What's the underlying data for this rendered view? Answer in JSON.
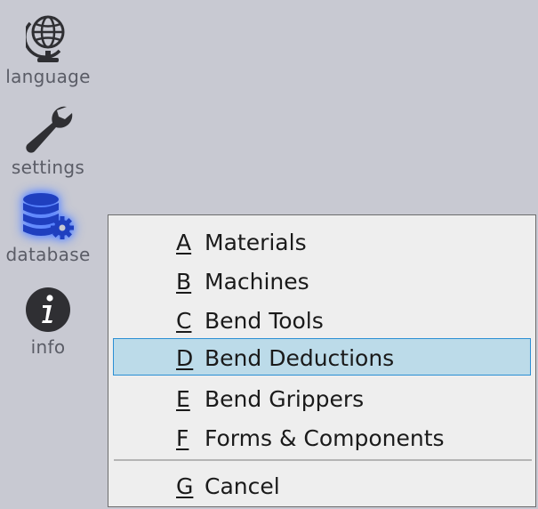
{
  "sidebar": {
    "items": [
      {
        "label": "language",
        "icon": "globe-icon"
      },
      {
        "label": "settings",
        "icon": "wrench-icon"
      },
      {
        "label": "database",
        "icon": "database-gear-icon",
        "active": true
      },
      {
        "label": "info",
        "icon": "info-icon"
      }
    ]
  },
  "menu": {
    "items": [
      {
        "key": "A",
        "label": "Materials"
      },
      {
        "key": "B",
        "label": "Machines"
      },
      {
        "key": "C",
        "label": "Bend Tools"
      },
      {
        "key": "D",
        "label": "Bend Deductions",
        "selected": true
      },
      {
        "key": "E",
        "label": "Bend Grippers"
      },
      {
        "key": "F",
        "label": "Forms & Components"
      },
      {
        "key": "G",
        "label": "Cancel"
      }
    ]
  },
  "colors": {
    "background": "#c8c9d2",
    "icon": "#2f2f33",
    "database_icon": "#1f3fbf",
    "selection_fill": "#bcdbe9",
    "selection_border": "#2b8fd4",
    "menu_background": "#eeeeee"
  }
}
